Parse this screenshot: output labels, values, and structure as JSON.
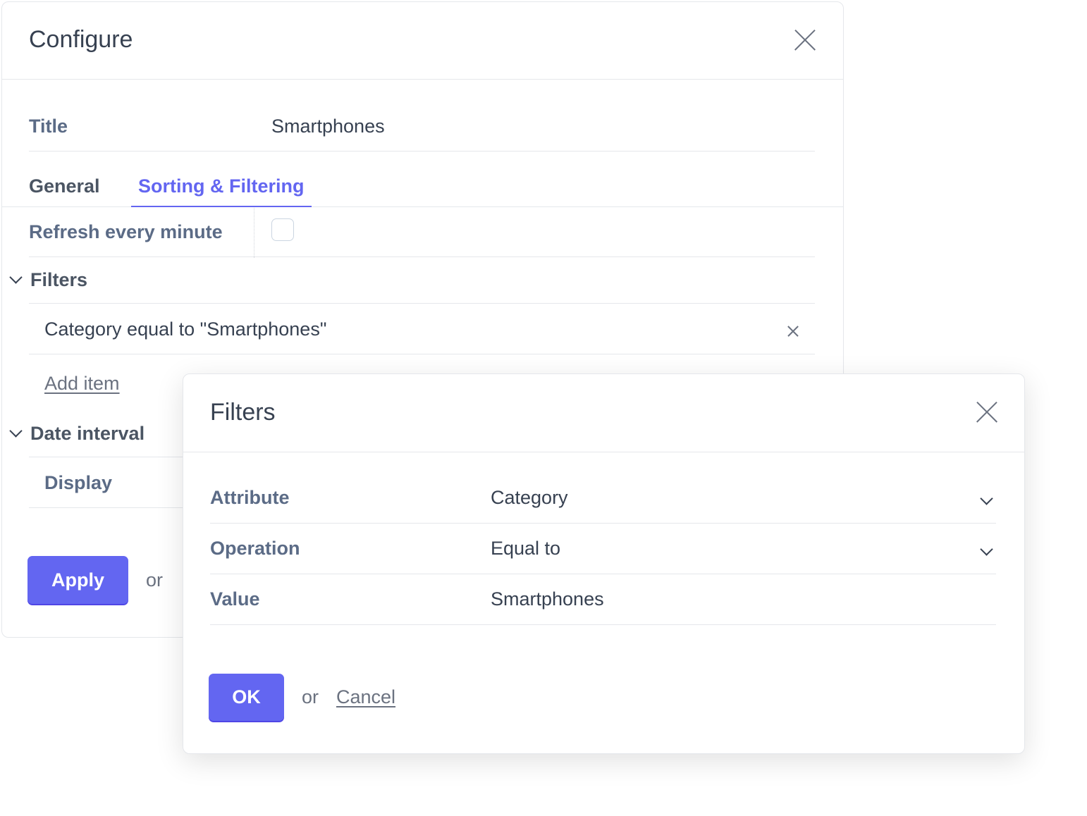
{
  "configure": {
    "title": "Configure",
    "title_field": {
      "label": "Title",
      "value": "Smartphones"
    },
    "tabs": [
      {
        "label": "General",
        "active": false
      },
      {
        "label": "Sorting & Filtering",
        "active": true
      }
    ],
    "refresh": {
      "label": "Refresh every minute",
      "checked": false
    },
    "filters_section": {
      "label": "Filters",
      "items": [
        "Category equal to \"Smartphones\""
      ],
      "add_item_label": "Add item"
    },
    "date_interval_section": {
      "label": "Date interval",
      "display_label": "Display"
    },
    "apply_label": "Apply",
    "or_text": "or"
  },
  "filters_dialog": {
    "title": "Filters",
    "fields": {
      "attribute": {
        "label": "Attribute",
        "value": "Category"
      },
      "operation": {
        "label": "Operation",
        "value": "Equal to"
      },
      "value": {
        "label": "Value",
        "value": "Smartphones"
      }
    },
    "ok_label": "OK",
    "or_text": "or",
    "cancel_label": "Cancel"
  },
  "colors": {
    "accent": "#6366f1",
    "label": "#5b6b86",
    "border": "#e5e7eb"
  }
}
